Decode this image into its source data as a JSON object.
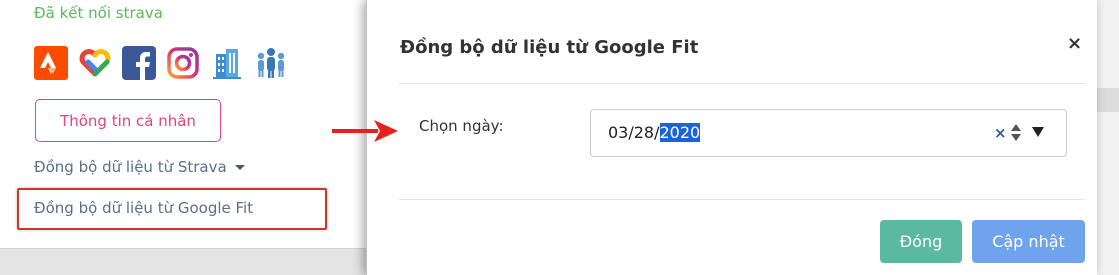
{
  "profile": {
    "strava_status": "Đã kết nối strava",
    "social_icons": [
      {
        "icon": "strava-icon",
        "color": "#fc4c02"
      },
      {
        "icon": "google-fit-icon",
        "color": "#34a853"
      },
      {
        "icon": "facebook-icon",
        "color": "#3b5998"
      },
      {
        "icon": "instagram-icon",
        "color": "#c13584"
      },
      {
        "icon": "company-icon",
        "color": "#3a8fd0"
      },
      {
        "icon": "community-icon",
        "color": "#3a78b5"
      }
    ],
    "profile_button": "Thông tin cá nhân",
    "sync_strava_link": "Đồng bộ dữ liệu từ Strava",
    "sync_google_fit_link": "Đồng bộ dữ liệu từ Google Fit"
  },
  "modal": {
    "title": "Đồng bộ dữ liệu từ Google Fit",
    "close_icon": "×",
    "date_label": "Chọn ngày:",
    "date_value_prefix": "03/28/",
    "date_value_selected": "2020",
    "clear_icon": "×",
    "buttons": {
      "close": "Đóng",
      "update": "Cập nhật"
    }
  },
  "annotations": {
    "highlight_color": "#d0342c",
    "arrow_color": "#e8201c"
  }
}
